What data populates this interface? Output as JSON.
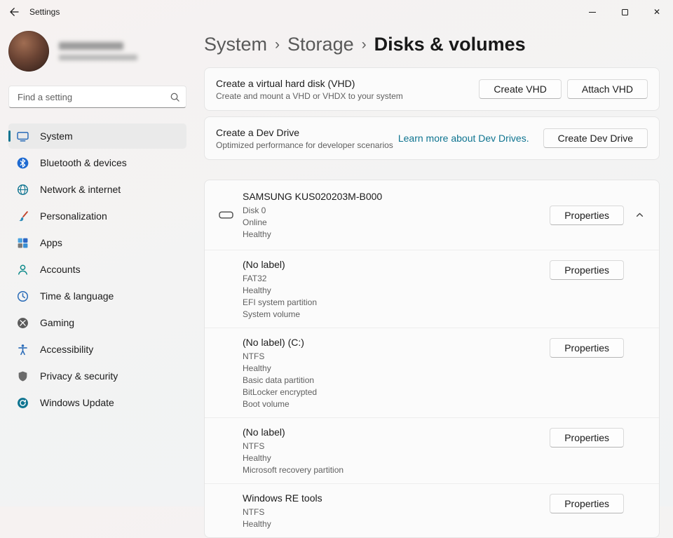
{
  "window": {
    "title": "Settings"
  },
  "sidebar": {
    "search_placeholder": "Find a setting",
    "nav": [
      {
        "label": "System",
        "selected": true
      },
      {
        "label": "Bluetooth & devices",
        "selected": false
      },
      {
        "label": "Network & internet",
        "selected": false
      },
      {
        "label": "Personalization",
        "selected": false
      },
      {
        "label": "Apps",
        "selected": false
      },
      {
        "label": "Accounts",
        "selected": false
      },
      {
        "label": "Time & language",
        "selected": false
      },
      {
        "label": "Gaming",
        "selected": false
      },
      {
        "label": "Accessibility",
        "selected": false
      },
      {
        "label": "Privacy & security",
        "selected": false
      },
      {
        "label": "Windows Update",
        "selected": false
      }
    ]
  },
  "breadcrumb": {
    "items": [
      "System",
      "Storage",
      "Disks & volumes"
    ],
    "separator": "›"
  },
  "vhd_card": {
    "title": "Create a virtual hard disk (VHD)",
    "subtitle": "Create and mount a VHD or VHDX to your system",
    "create_button": "Create VHD",
    "attach_button": "Attach VHD"
  },
  "dev_drive_card": {
    "title": "Create a Dev Drive",
    "subtitle": "Optimized performance for developer scenarios",
    "link": "Learn more about Dev Drives.",
    "button": "Create Dev Drive"
  },
  "disk_section": {
    "disk_name": "SAMSUNG KUS020203M-B000",
    "disk_details": [
      "Disk 0",
      "Online",
      "Healthy"
    ],
    "properties_label": "Properties",
    "volumes": [
      {
        "name": "(No label)",
        "details": [
          "FAT32",
          "Healthy",
          "EFI system partition",
          "System volume"
        ]
      },
      {
        "name": "(No label) (C:)",
        "details": [
          "NTFS",
          "Healthy",
          "Basic data partition",
          "BitLocker encrypted",
          "Boot volume"
        ]
      },
      {
        "name": "(No label)",
        "details": [
          "NTFS",
          "Healthy",
          "Microsoft recovery partition"
        ]
      },
      {
        "name": "Windows RE tools",
        "details": [
          "NTFS",
          "Healthy"
        ]
      }
    ]
  },
  "colors": {
    "accent": "#0e7490"
  }
}
